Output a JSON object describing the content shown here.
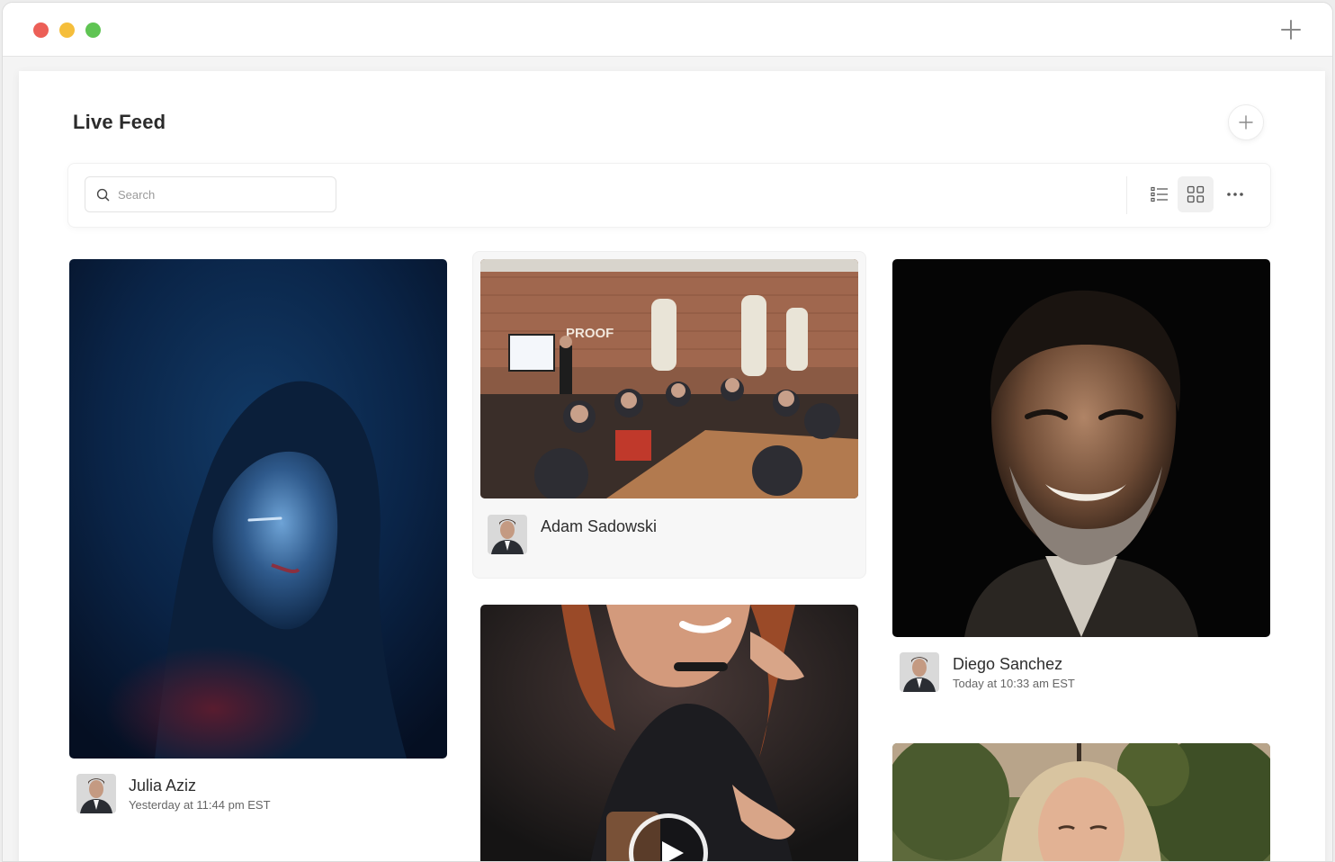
{
  "header": {
    "title": "Live Feed"
  },
  "search": {
    "placeholder": "Search"
  },
  "view_modes": [
    "list",
    "grid"
  ],
  "active_view": "grid",
  "posts": [
    {
      "author": "Julia Aziz",
      "time": "Yesterday at 11:44 pm EST",
      "media": "photo"
    },
    {
      "author": "Adam Sadowski",
      "time": "",
      "media": "photo"
    },
    {
      "author": "Diego Sanchez",
      "time": "Today at 10:33 am EST",
      "media": "photo"
    },
    {
      "author": "",
      "time": "",
      "media": "video"
    },
    {
      "author": "",
      "time": "",
      "media": "photo"
    }
  ],
  "colors": {
    "window_red": "#ec5f57",
    "window_yellow": "#f5be3b",
    "window_green": "#5fc453"
  }
}
